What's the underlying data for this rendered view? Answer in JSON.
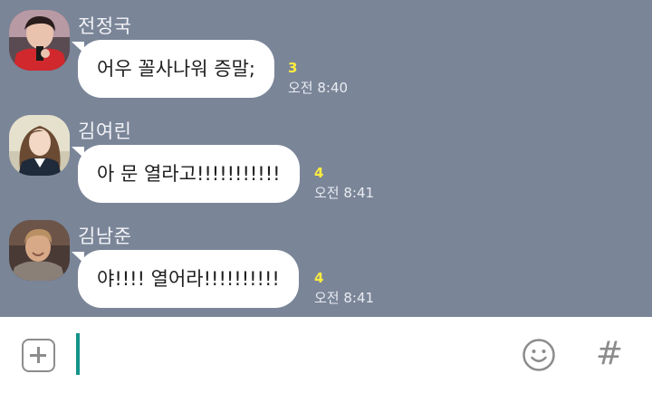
{
  "messages": [
    {
      "sender": "전정국",
      "text": "어우 꼴사나워 증말;",
      "unread": "3",
      "time": "오전 8:40"
    },
    {
      "sender": "김여린",
      "text": "아 문 열라고!!!!!!!!!!!",
      "unread": "4",
      "time": "오전 8:41"
    },
    {
      "sender": "김남준",
      "text": "야!!!! 열어라!!!!!!!!!!",
      "unread": "4",
      "time": "오전 8:41"
    }
  ],
  "input": {
    "value": "",
    "hash_label": "#"
  },
  "icons": {
    "attach": "plus-square-icon",
    "emoji": "smiley-icon",
    "hashtag": "hash-icon"
  },
  "colors": {
    "chat_background": "#7a8598",
    "unread_badge": "#ffec3f",
    "caret": "#13938a",
    "icon_gray": "#8c8c8c"
  }
}
